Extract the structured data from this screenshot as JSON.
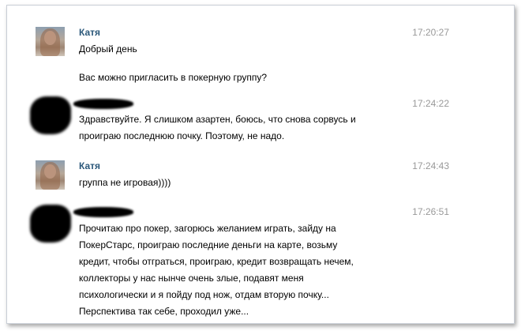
{
  "messages": [
    {
      "author": "Катя",
      "time": "17:20:27",
      "lines": [
        "Добрый день",
        "",
        "Вас можно пригласить в покерную группу?"
      ]
    },
    {
      "author": "",
      "time": "17:24:22",
      "lines": [
        "Здравствуйте. Я слишком азартен, боюсь, что снова сорвусь и",
        "проиграю последнюю почку. Поэтому, не надо."
      ]
    },
    {
      "author": "Катя",
      "time": "17:24:43",
      "lines": [
        "группа не игровая))))"
      ]
    },
    {
      "author": "",
      "time": "17:26:51",
      "lines": [
        "Прочитаю про покер, загорюсь желанием играть, зайду на",
        "ПокерСтарс, проиграю последние деньги на карте, возьму",
        "кредит, чтобы отграться, проиграю, кредит возвращать нечем,",
        "коллекторы у нас нынче очень злые, подавят меня",
        "психологически и я пойду под нож, отдам вторую почку...",
        "Перспектива так себе, проходил уже..."
      ]
    }
  ]
}
